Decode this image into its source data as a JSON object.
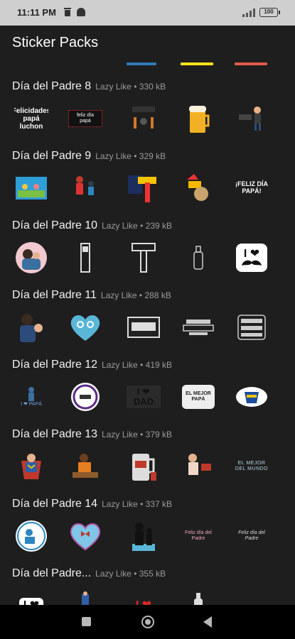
{
  "status_bar": {
    "time": "11:11 PM",
    "battery": "100"
  },
  "app": {
    "title": "Sticker Packs"
  },
  "packs": [
    {
      "name": "Día del Padre 8",
      "author": "Lazy Like",
      "size": "330 kB",
      "stickers": [
        "Felicidades papá luchon",
        "feliz día papá",
        "",
        "",
        ""
      ]
    },
    {
      "name": "Día del Padre 9",
      "author": "Lazy Like",
      "size": "329 kB",
      "stickers": [
        "",
        "",
        "",
        "",
        "¡FELIZ DÍA PAPÁ!"
      ]
    },
    {
      "name": "Día del Padre 10",
      "author": "Lazy Like",
      "size": "239 kB",
      "stickers": [
        "",
        "",
        "",
        "",
        "I ❤"
      ]
    },
    {
      "name": "Día del Padre 11",
      "author": "Lazy Like",
      "size": "288 kB",
      "stickers": [
        "",
        "",
        "",
        "",
        ""
      ]
    },
    {
      "name": "Día del Padre 12",
      "author": "Lazy Like",
      "size": "419 kB",
      "stickers": [
        "I ❤ PAPÁ",
        "",
        "I ❤ DAD",
        "EL MEJOR PAPÁ",
        ""
      ]
    },
    {
      "name": "Día del Padre 13",
      "author": "Lazy Like",
      "size": "379 kB",
      "stickers": [
        "",
        "",
        "",
        "",
        "EL MEJOR DEL MUNDO"
      ]
    },
    {
      "name": "Día del Padre 14",
      "author": "Lazy Like",
      "size": "337 kB",
      "stickers": [
        "",
        "",
        "",
        "Feliz día del Padre",
        "Feliz día del Padre"
      ]
    },
    {
      "name": "Día del Padre...",
      "author": "Lazy Like",
      "size": "355 kB",
      "stickers": [
        "I ❤",
        "",
        "I ❤",
        "",
        ""
      ]
    }
  ],
  "colors": {
    "background": "#1e1e1e",
    "meta_text": "#9a9a9a",
    "nav_bar": "#000000"
  }
}
